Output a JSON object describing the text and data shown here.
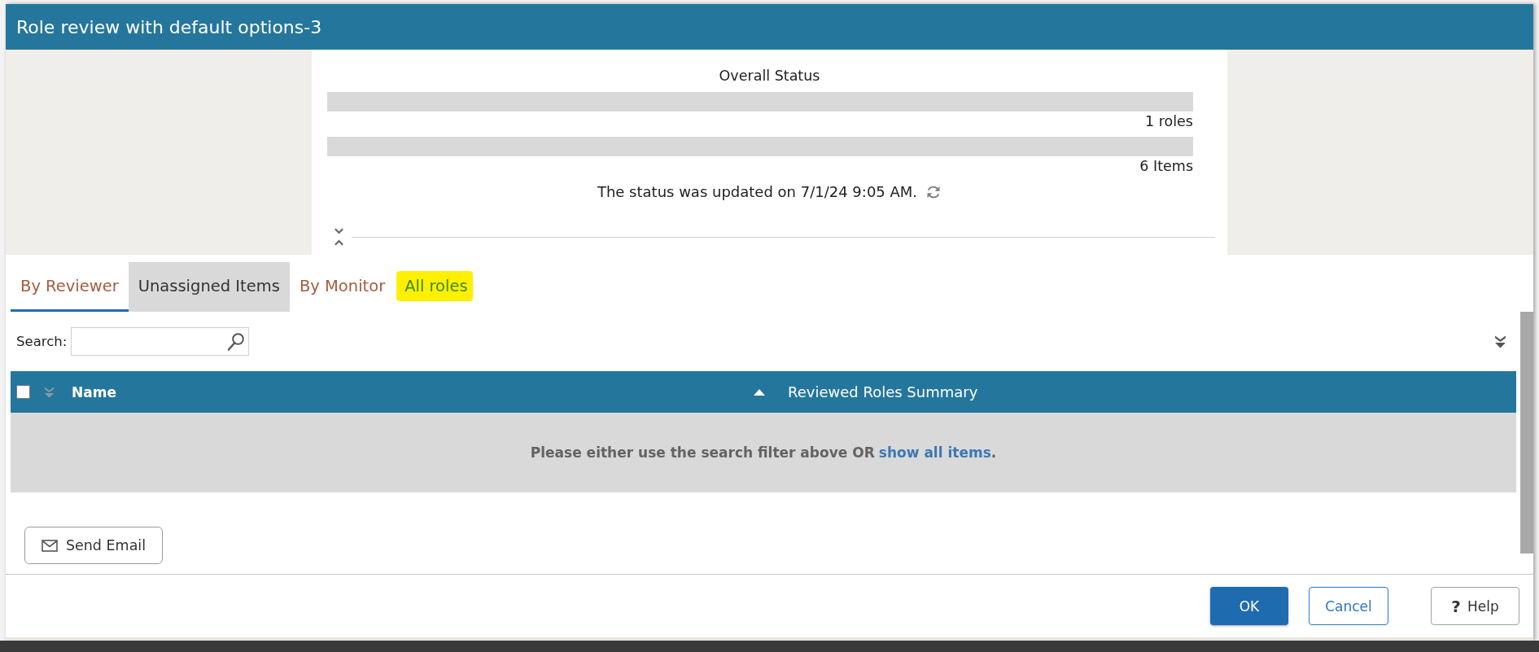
{
  "window": {
    "title": "Role review with default options-3"
  },
  "status": {
    "title": "Overall Status",
    "meters": [
      {
        "level": 0,
        "reading": "1 roles"
      },
      {
        "level": 0,
        "reading": "6 Items"
      }
    ],
    "updated": "The status was updated on 7/1/24 9:05 AM."
  },
  "tabs": [
    {
      "label": "By Reviewer",
      "selected": true,
      "hovered": false,
      "highlighted": false
    },
    {
      "label": "Unassigned Items",
      "selected": false,
      "hovered": true,
      "highlighted": false
    },
    {
      "label": "By Monitor",
      "selected": false,
      "hovered": false,
      "highlighted": false
    },
    {
      "label": "All roles",
      "selected": false,
      "hovered": false,
      "highlighted": true
    }
  ],
  "search": {
    "label": "Search:"
  },
  "table": {
    "select_all": {
      "checked": false
    },
    "columns": [
      {
        "label": "Name",
        "sorted": true
      },
      {
        "label": "Reviewed Roles Summary",
        "sorted": false
      }
    ],
    "empty_message": {
      "text": "Please either use the search filter above OR",
      "link": "show all items",
      "end": "."
    }
  },
  "actions": [
    {
      "label": "Send Email",
      "kind": "email"
    }
  ],
  "footer_buttons": [
    {
      "label": "OK",
      "kind": "primary"
    },
    {
      "label": "Cancel",
      "kind": "secondary"
    },
    {
      "label": "Help",
      "kind": "help",
      "icon": "?"
    }
  ]
}
